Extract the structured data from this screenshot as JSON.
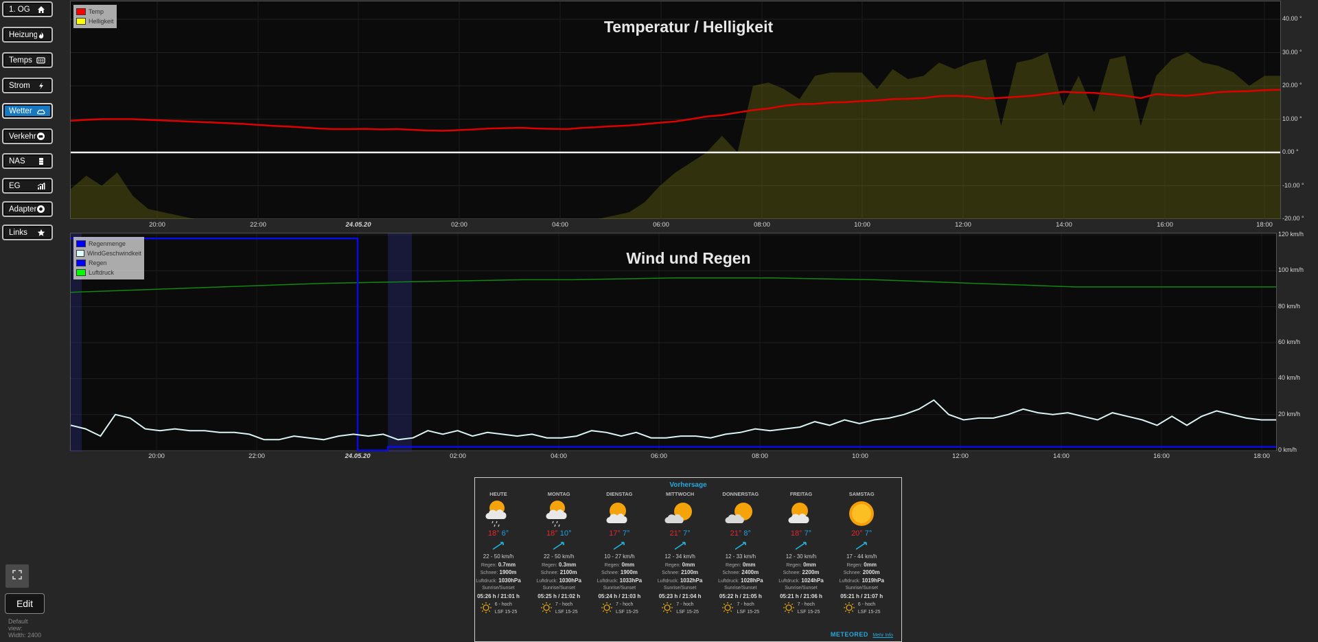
{
  "sidebar": {
    "items": [
      {
        "label": "1. OG",
        "icon": "home-icon",
        "active": false
      },
      {
        "label": "Heizung",
        "icon": "flame-icon",
        "active": false
      },
      {
        "label": "Temps",
        "icon": "thermometer-icon",
        "active": false
      },
      {
        "label": "Strom",
        "icon": "lightning-icon",
        "active": false
      },
      {
        "label": "Wetter",
        "icon": "cloud-icon",
        "active": true
      },
      {
        "label": "Verkehr",
        "icon": "traffic-icon",
        "active": false
      },
      {
        "label": "NAS",
        "icon": "database-icon",
        "active": false
      },
      {
        "label": "EG",
        "icon": "chart-icon",
        "active": false
      },
      {
        "label": "Adapter",
        "icon": "plug-icon",
        "active": false
      },
      {
        "label": "Links",
        "icon": "star-icon",
        "active": false
      }
    ]
  },
  "bottom": {
    "edit_label": "Edit",
    "view_line1": "Default",
    "view_line2": "view:",
    "view_line3": "Width: 2400"
  },
  "charts": {
    "temp": {
      "title": "Temperatur / Helligkeit",
      "legend": [
        {
          "label": "Temp",
          "color": "#ff0000"
        },
        {
          "label": "Helligkeit",
          "color": "#ffff00"
        }
      ],
      "yticks": [
        "40.00 °",
        "30.00 °",
        "20.00 °",
        "10.00 °",
        "0.00 °",
        "-10.00 °",
        "-20.00 °"
      ],
      "xticks": [
        "20:00",
        "22:00",
        "24.05.20",
        "02:00",
        "04:00",
        "06:00",
        "08:00",
        "10:00",
        "12:00",
        "14:00",
        "16:00",
        "18:00"
      ]
    },
    "wind": {
      "title": "Wind und Regen",
      "legend": [
        {
          "label": "Regenmenge",
          "color": "#0000ff"
        },
        {
          "label": "WindGeschwindkeit",
          "color": "#e0ffff"
        },
        {
          "label": "Regen",
          "color": "#0000ff"
        },
        {
          "label": "Luftdruck",
          "color": "#00ff00"
        }
      ],
      "yticks": [
        "120 km/h",
        "100 km/h",
        "80 km/h",
        "60 km/h",
        "40 km/h",
        "20 km/h",
        "0 km/h"
      ],
      "xticks": [
        "20:00",
        "22:00",
        "24.05.20",
        "02:00",
        "04:00",
        "06:00",
        "08:00",
        "10:00",
        "12:00",
        "14:00",
        "16:00",
        "18:00"
      ]
    }
  },
  "chart_data": [
    {
      "type": "line",
      "title": "Temperatur / Helligkeit",
      "x_unit": "hours since 18:15 (23.05.20)",
      "series": [
        {
          "name": "Temp",
          "color": "#ff0000",
          "values": [
            9.5,
            9.8,
            10,
            10,
            10,
            9.8,
            9.6,
            9.4,
            9.2,
            9,
            8.8,
            8.6,
            8.3,
            8,
            7.8,
            7.5,
            7.2,
            7,
            7,
            7.1,
            6.9,
            7,
            6.8,
            6.6,
            6.5,
            6.7,
            6.9,
            7.2,
            7.3,
            7.4,
            7.2,
            7.1,
            7,
            7.4,
            7.6,
            7.9,
            8.1,
            8.5,
            8.9,
            9.3,
            10,
            10.8,
            11.2,
            12,
            12.7,
            13.2,
            14,
            14.5,
            14.6,
            15,
            15.1,
            15.4,
            15.6,
            16,
            16.1,
            16.3,
            16.9,
            17,
            16.8,
            16.2,
            16.4,
            16.7,
            17,
            17.6,
            18.2,
            18,
            17.9,
            17.5,
            17,
            16.3,
            17.5,
            17.2,
            17,
            17.5,
            18.1,
            18.3,
            18.4,
            18.7,
            18.8
          ]
        },
        {
          "name": "Helligkeit",
          "color": "#ffff00",
          "values": [
            -11,
            -7,
            -10,
            -6,
            -13,
            -17,
            -18,
            -19,
            -20,
            -20,
            -20,
            -20,
            -20,
            -20,
            -20,
            -20,
            -20,
            -20,
            -20,
            -20,
            -20,
            -20,
            -20,
            -20,
            -20,
            -20,
            -20,
            -20,
            -20,
            -20,
            -20,
            -20,
            -20,
            -20,
            -20,
            -19,
            -18,
            -15,
            -10,
            -6,
            -3,
            0,
            5,
            0,
            20,
            21,
            19,
            16,
            23,
            24,
            24,
            24,
            19,
            25,
            22,
            23,
            27,
            25,
            27,
            28,
            8,
            27,
            28,
            30,
            14,
            23,
            12,
            28,
            29,
            8,
            23,
            28,
            30,
            27,
            26,
            24,
            20,
            23,
            23
          ]
        }
      ],
      "ylim": [
        -20,
        40
      ],
      "xticks": [
        "20:00",
        "22:00",
        "24.05.20",
        "02:00",
        "04:00",
        "06:00",
        "08:00",
        "10:00",
        "12:00",
        "14:00",
        "16:00",
        "18:00"
      ]
    },
    {
      "type": "line",
      "title": "Wind und Regen",
      "series": [
        {
          "name": "WindGeschwindkeit",
          "color": "#e0ffff",
          "values": [
            14,
            12,
            8,
            20,
            18,
            12,
            11,
            12,
            11,
            11,
            10,
            10,
            9,
            6,
            6,
            8,
            7,
            6,
            8,
            9,
            8,
            9,
            6,
            7,
            11,
            9,
            11,
            8,
            10,
            9,
            8,
            9,
            7,
            7,
            8,
            11,
            10,
            8,
            10,
            7,
            7,
            8,
            8,
            7,
            9,
            10,
            12,
            11,
            12,
            13,
            16,
            14,
            17,
            15,
            17,
            18,
            20,
            23,
            28,
            20,
            17,
            18,
            18,
            20,
            23,
            21,
            20,
            21,
            19,
            17,
            21,
            19,
            17,
            14,
            19,
            14,
            19,
            22,
            20,
            18,
            17,
            17
          ]
        },
        {
          "name": "Luftdruck",
          "color": "#00ff00",
          "values": [
            88,
            89,
            90,
            91,
            92,
            93,
            93.5,
            94,
            94.5,
            95,
            95,
            95.5,
            96,
            96,
            96,
            95.5,
            95,
            94,
            93,
            92,
            91,
            91,
            91,
            91,
            91
          ]
        },
        {
          "name": "Regenmenge",
          "color": "#0000ff",
          "values": [
            118,
            118,
            0,
            2,
            2,
            2,
            2,
            2
          ]
        },
        {
          "name": "Regen",
          "color": "#0000ff",
          "values": []
        }
      ],
      "ylim": [
        0,
        120
      ],
      "xticks": [
        "20:00",
        "22:00",
        "24.05.20",
        "02:00",
        "04:00",
        "06:00",
        "08:00",
        "10:00",
        "12:00",
        "14:00",
        "16:00",
        "18:00"
      ]
    }
  ],
  "forecast": {
    "title": "Vorhersage",
    "brand": "METEORED",
    "more": "Mehr Info",
    "days": [
      {
        "name": "HEUTE",
        "icon": "sun-cloud-rain-icon",
        "max": "18°",
        "min": "6°",
        "wind": "22 - 50 km/h",
        "regen": "0.7mm",
        "schnee": "1900m",
        "luftdruck": "1030hPa",
        "sun": "05:26 h  / 21:01 h",
        "uv": "6 - hoch",
        "lsf": "LSF 15-25"
      },
      {
        "name": "MONTAG",
        "icon": "sun-cloud-rain-icon",
        "max": "18°",
        "min": "10°",
        "wind": "22 - 50 km/h",
        "regen": "0.3mm",
        "schnee": "2100m",
        "luftdruck": "1030hPa",
        "sun": "05:25 h  / 21:02 h",
        "uv": "7 - hoch",
        "lsf": "LSF 15-25"
      },
      {
        "name": "DIENSTAG",
        "icon": "sun-cloud-icon",
        "max": "17°",
        "min": "7°",
        "wind": "10 - 27 km/h",
        "regen": "0mm",
        "schnee": "1900m",
        "luftdruck": "1033hPa",
        "sun": "05:24 h  / 21:03 h",
        "uv": "7 - hoch",
        "lsf": "LSF 15-25"
      },
      {
        "name": "MITTWOCH",
        "icon": "cloud-sun-icon",
        "max": "21°",
        "min": "7°",
        "wind": "12 - 34 km/h",
        "regen": "0mm",
        "schnee": "2100m",
        "luftdruck": "1032hPa",
        "sun": "05:23 h  / 21:04 h",
        "uv": "7 - hoch",
        "lsf": "LSF 15-25"
      },
      {
        "name": "DONNERSTAG",
        "icon": "cloud-sun-icon",
        "max": "21°",
        "min": "8°",
        "wind": "12 - 33 km/h",
        "regen": "0mm",
        "schnee": "2400m",
        "luftdruck": "1028hPa",
        "sun": "05:22 h  / 21:05 h",
        "uv": "7 - hoch",
        "lsf": "LSF 15-25"
      },
      {
        "name": "FREITAG",
        "icon": "sun-cloud-icon",
        "max": "18°",
        "min": "7°",
        "wind": "12 - 30 km/h",
        "regen": "0mm",
        "schnee": "2200m",
        "luftdruck": "1024hPa",
        "sun": "05:21 h  / 21:06 h",
        "uv": "7 - hoch",
        "lsf": "LSF 15-25"
      },
      {
        "name": "SAMSTAG",
        "icon": "sun-icon",
        "max": "20°",
        "min": "7°",
        "wind": "17 - 44 km/h",
        "regen": "0mm",
        "schnee": "2000m",
        "luftdruck": "1019hPa",
        "sun": "05:21 h  / 21:07 h",
        "uv": "6 - hoch",
        "lsf": "LSF 15-25"
      }
    ],
    "labels": {
      "regen": "Regen:",
      "schnee": "Schnee:",
      "luftdruck": "Luftdruck:",
      "sun": "Sunrise/Sunset"
    }
  }
}
